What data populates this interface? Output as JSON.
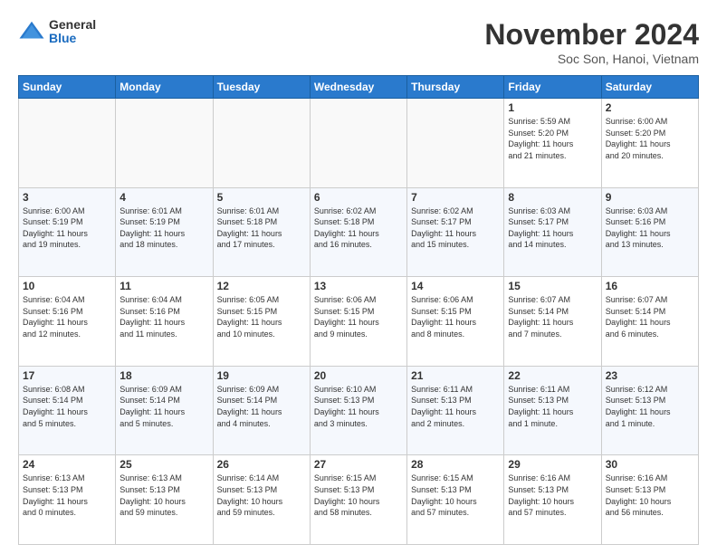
{
  "header": {
    "logo_general": "General",
    "logo_blue": "Blue",
    "title": "November 2024",
    "subtitle": "Soc Son, Hanoi, Vietnam"
  },
  "weekdays": [
    "Sunday",
    "Monday",
    "Tuesday",
    "Wednesday",
    "Thursday",
    "Friday",
    "Saturday"
  ],
  "weeks": [
    [
      {
        "day": "",
        "info": ""
      },
      {
        "day": "",
        "info": ""
      },
      {
        "day": "",
        "info": ""
      },
      {
        "day": "",
        "info": ""
      },
      {
        "day": "",
        "info": ""
      },
      {
        "day": "1",
        "info": "Sunrise: 5:59 AM\nSunset: 5:20 PM\nDaylight: 11 hours\nand 21 minutes."
      },
      {
        "day": "2",
        "info": "Sunrise: 6:00 AM\nSunset: 5:20 PM\nDaylight: 11 hours\nand 20 minutes."
      }
    ],
    [
      {
        "day": "3",
        "info": "Sunrise: 6:00 AM\nSunset: 5:19 PM\nDaylight: 11 hours\nand 19 minutes."
      },
      {
        "day": "4",
        "info": "Sunrise: 6:01 AM\nSunset: 5:19 PM\nDaylight: 11 hours\nand 18 minutes."
      },
      {
        "day": "5",
        "info": "Sunrise: 6:01 AM\nSunset: 5:18 PM\nDaylight: 11 hours\nand 17 minutes."
      },
      {
        "day": "6",
        "info": "Sunrise: 6:02 AM\nSunset: 5:18 PM\nDaylight: 11 hours\nand 16 minutes."
      },
      {
        "day": "7",
        "info": "Sunrise: 6:02 AM\nSunset: 5:17 PM\nDaylight: 11 hours\nand 15 minutes."
      },
      {
        "day": "8",
        "info": "Sunrise: 6:03 AM\nSunset: 5:17 PM\nDaylight: 11 hours\nand 14 minutes."
      },
      {
        "day": "9",
        "info": "Sunrise: 6:03 AM\nSunset: 5:16 PM\nDaylight: 11 hours\nand 13 minutes."
      }
    ],
    [
      {
        "day": "10",
        "info": "Sunrise: 6:04 AM\nSunset: 5:16 PM\nDaylight: 11 hours\nand 12 minutes."
      },
      {
        "day": "11",
        "info": "Sunrise: 6:04 AM\nSunset: 5:16 PM\nDaylight: 11 hours\nand 11 minutes."
      },
      {
        "day": "12",
        "info": "Sunrise: 6:05 AM\nSunset: 5:15 PM\nDaylight: 11 hours\nand 10 minutes."
      },
      {
        "day": "13",
        "info": "Sunrise: 6:06 AM\nSunset: 5:15 PM\nDaylight: 11 hours\nand 9 minutes."
      },
      {
        "day": "14",
        "info": "Sunrise: 6:06 AM\nSunset: 5:15 PM\nDaylight: 11 hours\nand 8 minutes."
      },
      {
        "day": "15",
        "info": "Sunrise: 6:07 AM\nSunset: 5:14 PM\nDaylight: 11 hours\nand 7 minutes."
      },
      {
        "day": "16",
        "info": "Sunrise: 6:07 AM\nSunset: 5:14 PM\nDaylight: 11 hours\nand 6 minutes."
      }
    ],
    [
      {
        "day": "17",
        "info": "Sunrise: 6:08 AM\nSunset: 5:14 PM\nDaylight: 11 hours\nand 5 minutes."
      },
      {
        "day": "18",
        "info": "Sunrise: 6:09 AM\nSunset: 5:14 PM\nDaylight: 11 hours\nand 5 minutes."
      },
      {
        "day": "19",
        "info": "Sunrise: 6:09 AM\nSunset: 5:14 PM\nDaylight: 11 hours\nand 4 minutes."
      },
      {
        "day": "20",
        "info": "Sunrise: 6:10 AM\nSunset: 5:13 PM\nDaylight: 11 hours\nand 3 minutes."
      },
      {
        "day": "21",
        "info": "Sunrise: 6:11 AM\nSunset: 5:13 PM\nDaylight: 11 hours\nand 2 minutes."
      },
      {
        "day": "22",
        "info": "Sunrise: 6:11 AM\nSunset: 5:13 PM\nDaylight: 11 hours\nand 1 minute."
      },
      {
        "day": "23",
        "info": "Sunrise: 6:12 AM\nSunset: 5:13 PM\nDaylight: 11 hours\nand 1 minute."
      }
    ],
    [
      {
        "day": "24",
        "info": "Sunrise: 6:13 AM\nSunset: 5:13 PM\nDaylight: 11 hours\nand 0 minutes."
      },
      {
        "day": "25",
        "info": "Sunrise: 6:13 AM\nSunset: 5:13 PM\nDaylight: 10 hours\nand 59 minutes."
      },
      {
        "day": "26",
        "info": "Sunrise: 6:14 AM\nSunset: 5:13 PM\nDaylight: 10 hours\nand 59 minutes."
      },
      {
        "day": "27",
        "info": "Sunrise: 6:15 AM\nSunset: 5:13 PM\nDaylight: 10 hours\nand 58 minutes."
      },
      {
        "day": "28",
        "info": "Sunrise: 6:15 AM\nSunset: 5:13 PM\nDaylight: 10 hours\nand 57 minutes."
      },
      {
        "day": "29",
        "info": "Sunrise: 6:16 AM\nSunset: 5:13 PM\nDaylight: 10 hours\nand 57 minutes."
      },
      {
        "day": "30",
        "info": "Sunrise: 6:16 AM\nSunset: 5:13 PM\nDaylight: 10 hours\nand 56 minutes."
      }
    ]
  ]
}
